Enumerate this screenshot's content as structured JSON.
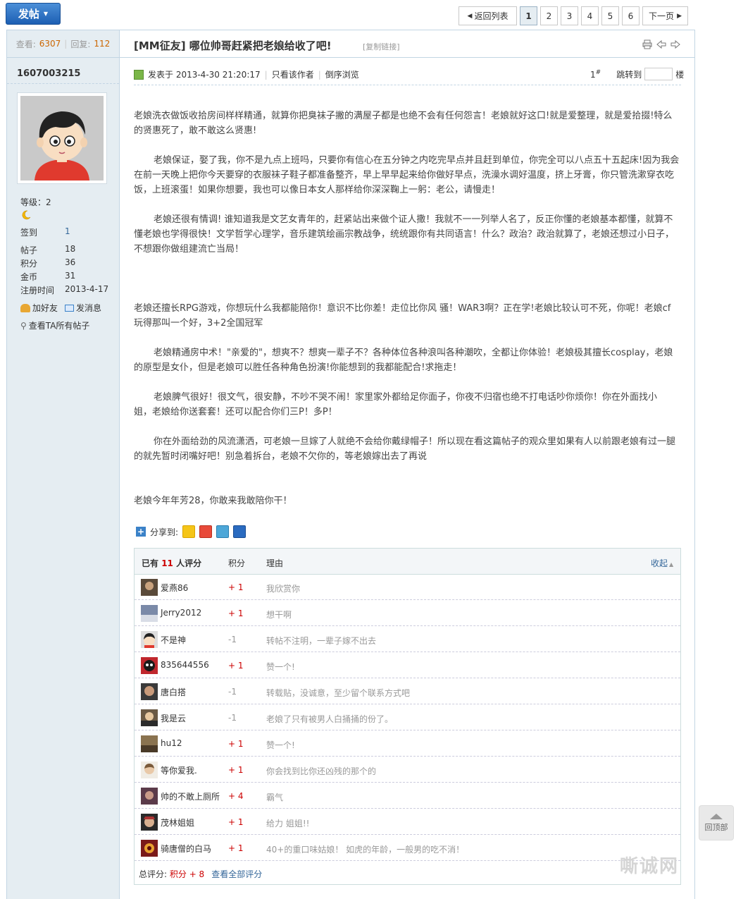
{
  "toolbar": {
    "post_label": "发帖",
    "back_label": "返回列表",
    "pages": [
      "1",
      "2",
      "3",
      "4",
      "5",
      "6"
    ],
    "current_page": "1",
    "next_label": "下一页"
  },
  "stats": {
    "views_label": "查看:",
    "views": "6307",
    "replies_label": "回复:",
    "replies": "112"
  },
  "post": {
    "title": "[MM征友] 哪位帅哥赶紧把老娘给收了吧!",
    "copy_link": "[复制链接]"
  },
  "author": {
    "name": "1607003215",
    "level": "等级：2",
    "fields": [
      {
        "label": "签到",
        "value": "1"
      },
      {
        "label": "帖子",
        "value": "18"
      },
      {
        "label": "积分",
        "value": "36"
      },
      {
        "label": "金币",
        "value": "31"
      },
      {
        "label": "注册时间",
        "value": "2013-4-17"
      }
    ],
    "add_friend": "加好友",
    "send_message": "发消息",
    "view_all": "查看TA所有帖子"
  },
  "meta": {
    "posted": "发表于 2013-4-30 21:20:17",
    "only_author": "只看该作者",
    "reverse": "倒序浏览",
    "floor": "1",
    "floor_mark": "#",
    "jump_label": "跳转到",
    "floor_unit": "楼"
  },
  "content": [
    "老娘洗衣做饭收拾房间样样精通，就算你把臭袜子撇的满屋子都是也绝不会有任何怨言！老娘就好这口!就是爱整理，就是爱拾掇!特么的贤惠死了，敢不敢这么贤惠!",
    "老娘保证，娶了我，你不是九点上班吗，只要你有信心在五分钟之内吃完早点并且赶到单位，你完全可以八点五十五起床!因为我会在前一天晚上把你今天要穿的衣服袜子鞋子都准备整齐，早上早早起来给你做好早点，洗澡水调好温度，挤上牙膏，你只管洗漱穿衣吃饭，上班滚蛋！如果你想要，我也可以像日本女人那样给你深深鞠上一躬：老公，请慢走！",
    "老娘还很有情调! 谁知道我是文艺女青年的，赶紧站出来做个证人撒！我就不一一列举人名了，反正你懂的老娘基本都懂，就算不懂老娘也学得很快！文学哲学心理学，音乐建筑绘画宗教战争，统统跟你有共同语言！什么？政治？政治就算了，老娘还想过小日子，不想跟你做组建流亡当局！",
    "老娘还擅长RPG游戏，你想玩什么我都能陪你！意识不比你差！走位比你风 骚！WAR3啊？正在学!老娘比较认可不死，你呢！老娘cf玩得那叫一个好，3+2全国冠军",
    "老娘精通房中术！\"亲爱的\"，想爽不？想爽一辈子不？各种体位各种浪叫各种潮吹，全都让你体验！老娘极其擅长cosplay，老娘的原型是女仆，但是老娘可以胜任各种角色扮演!你能想到的我都能配合!求拖走！",
    "老娘脾气很好！很文气，很安静，不吵不哭不闹！家里家外都给足你面子，你夜不归宿也绝不打电话吵你烦你！你在外面找小　　　　　　　　姐，老娘给你送套套！还可以配合你们三P！多P！",
    "你在外面给劲的风流潇洒，可老娘一旦嫁了人就绝不会给你戴绿帽子！所以现在看这篇帖子的观众里如果有人以前跟老娘有过一腿的就先暂时闭嘴好吧！别急着拆台，老娘不欠你的，等老娘嫁出去了再说",
    "老娘今年年芳28，你敢来我敢陪你干！"
  ],
  "share": {
    "label": "分享到:"
  },
  "ratings": {
    "header_prefix": "已有",
    "count": "11",
    "header_suffix": "人评分",
    "col_score": "积分",
    "col_reason": "理由",
    "collapse": "收起",
    "rows": [
      {
        "name": "爱燕86",
        "score": "+ 1",
        "reason": "我欣赏你"
      },
      {
        "name": "Jerry2012",
        "score": "+ 1",
        "reason": "想干啊"
      },
      {
        "name": "不是神",
        "score": "-1",
        "reason": "转帖不注明，一辈子嫁不出去"
      },
      {
        "name": "835644556",
        "score": "+ 1",
        "reason": "赞一个!"
      },
      {
        "name": "唐白搭",
        "score": "-1",
        "reason": "转载贴，没诚意，至少留个联系方式吧"
      },
      {
        "name": "我是云",
        "score": "-1",
        "reason": "老娘了只有被男人白捅捅的份了。"
      },
      {
        "name": "hu12",
        "score": "+ 1",
        "reason": "赞一个!"
      },
      {
        "name": "等你爱我.",
        "score": "+ 1",
        "reason": "你会找到比你还凶残的那个的"
      },
      {
        "name": "帅的不敢上厕所",
        "score": "+ 4",
        "reason": "霸气"
      },
      {
        "name": "茂林姐姐",
        "score": "+ 1",
        "reason": "给力 姐姐!!"
      },
      {
        "name": "骑唐僧的白马",
        "score": "+ 1",
        "reason": "40+的重口味姑娘！ 如虎的年龄，一般男的吃不消！"
      }
    ],
    "total_label": "总评分:",
    "total_value": "积分 + 8",
    "view_all": "查看全部评分"
  },
  "back_to_top": "回顶部",
  "watermark": "嘶诚网"
}
